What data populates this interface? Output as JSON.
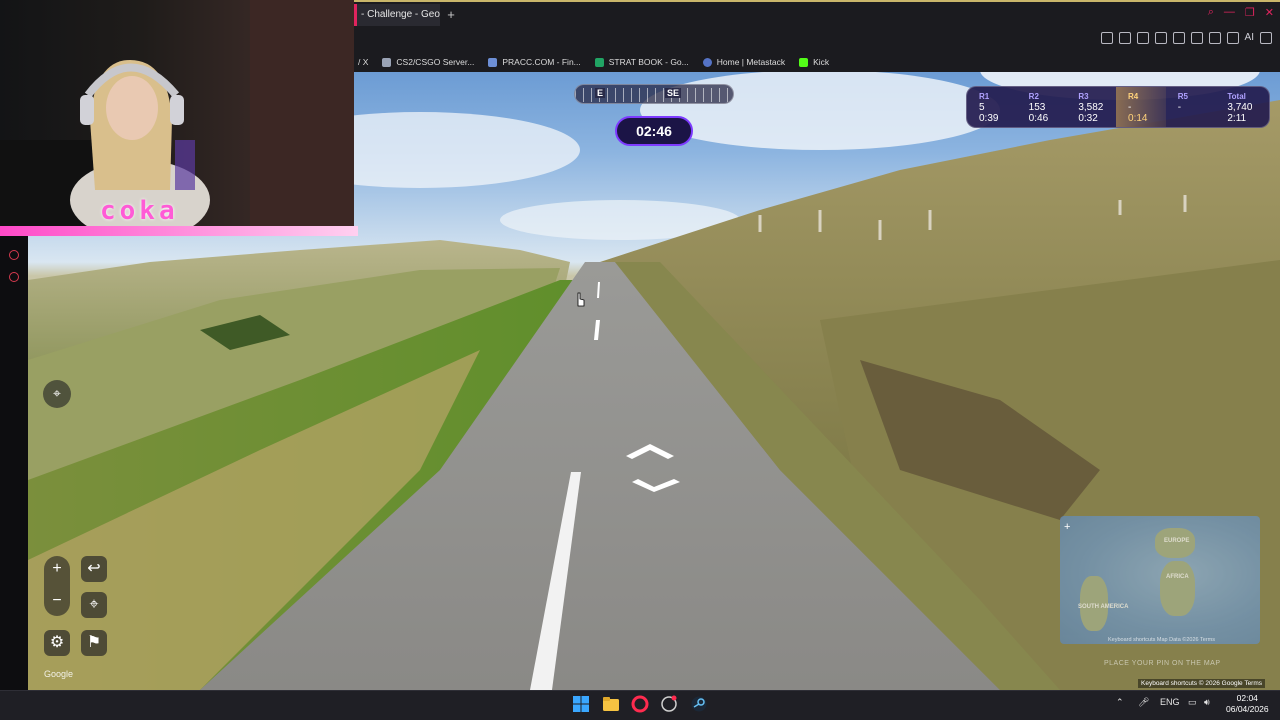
{
  "browser": {
    "tab_title": "- Challenge - GeoG",
    "new_tab_symbol": "+",
    "ai_label": "AI",
    "bookmarks": [
      {
        "label": "/ X",
        "icon": ""
      },
      {
        "label": "CS2/CSGO Server...",
        "icon": "server-icon"
      },
      {
        "label": "PRACC.COM - Fin...",
        "icon": "pracc-icon"
      },
      {
        "label": "STRAT BOOK - Go...",
        "icon": "sheets-icon"
      },
      {
        "label": "Home | Metastack",
        "icon": "metastack-icon"
      },
      {
        "label": "Kick",
        "icon": "kick-icon"
      }
    ],
    "colors": {
      "accent": "#e0245e",
      "frame": "#1b1b1f"
    }
  },
  "webcam": {
    "streamer_name": "coka",
    "border_color": "#ff49c8"
  },
  "game": {
    "compass": {
      "left": "E",
      "right": "SE"
    },
    "timer": "02:46",
    "rounds": [
      {
        "label": "R1",
        "score": "5",
        "time": "0:39"
      },
      {
        "label": "R2",
        "score": "153",
        "time": "0:46"
      },
      {
        "label": "R3",
        "score": "3,582",
        "time": "0:32"
      },
      {
        "label": "R4",
        "score": "-",
        "time": "0:14"
      },
      {
        "label": "R5",
        "score": "-",
        "time": ""
      },
      {
        "label": "Total",
        "score": "3,740",
        "time": "2:11"
      }
    ],
    "controls": {
      "zoom_in": "+",
      "zoom_out": "−",
      "undo": "↩",
      "settings": "⚙",
      "flag": "⚑"
    },
    "google_logo": "Google",
    "minimap": {
      "plus": "+",
      "labels": [
        "EUROPE",
        "AFRICA",
        "SOUTH AMERICA"
      ],
      "footer_left": "Google",
      "footer_right": "Keyboard shortcuts   Map Data ©2026   Terms",
      "place_guess": "PLACE YOUR PIN ON THE MAP"
    },
    "streetview_attribution": "Keyboard shortcuts  © 2026 Google  Terms"
  },
  "taskbar": {
    "language": "ENG",
    "time": "02:04",
    "date": "06/04/2026"
  }
}
